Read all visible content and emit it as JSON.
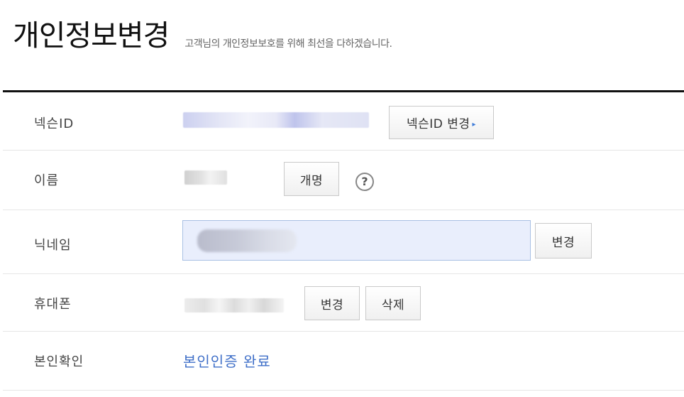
{
  "header": {
    "title": "개인정보변경",
    "subtitle": "고객님의 개인정보보호를 위해 최선을 다하겠습니다."
  },
  "rows": {
    "nexon_id": {
      "label": "넥슨ID",
      "change_button": "넥슨ID 변경",
      "arrow_icon": "▸"
    },
    "name": {
      "label": "이름",
      "rename_button": "개명",
      "help_icon": "?"
    },
    "nickname": {
      "label": "닉네임",
      "change_button": "변경"
    },
    "phone": {
      "label": "휴대폰",
      "change_button": "변경",
      "delete_button": "삭제"
    },
    "verification": {
      "label": "본인확인",
      "status": "본인인증 완료"
    }
  },
  "colors": {
    "accent": "#3f6fc8",
    "input_bg": "#e9eefc",
    "rule": "#111111"
  }
}
